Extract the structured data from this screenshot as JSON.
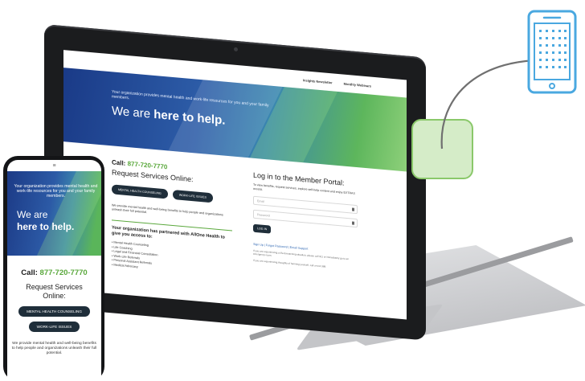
{
  "laptop": {
    "nav": [
      "Insights Newsletter",
      "Monthly Webinars"
    ],
    "hero_small": "Your organization provides mental health and work-life resources for you and your family members.",
    "hero_prefix": "We are ",
    "hero_bold": "here to help.",
    "call_label": "Call: ",
    "call_number": "877-720-7770",
    "request_title": "Request Services Online:",
    "btn_mental": "MENTAL HEALTH COUNSELING",
    "btn_worklife": "WORK-LIFE ISSUES",
    "para": "We provide mental health and well-being benefits to help people and organizations unleash their full potential.",
    "partner_text": "Your organization has partnered with AllOne Health to give you access to:",
    "list": [
      "Mental Health Counseling",
      "Life Coaching",
      "Legal and Financial Consultation",
      "Work-Life Referrals",
      "Personal Assistant Referrals",
      "Medical Advocacy"
    ],
    "login_title": "Log in to the Member Portal:",
    "login_desc": "To view benefits, request services, explore self-help content and enjoy EXTRAS access.",
    "email_placeholder": "Email",
    "password_placeholder": "Password",
    "login_button": "LOG IN",
    "forgot": "Sign Up | Forgot Password | Email Support",
    "note1": "If you are experiencing a life-threatening situation, please call 911 or immediately go to an emergency room.",
    "note2": "If you are experiencing thoughts of harming yourself, call or text 988."
  },
  "phone": {
    "hero_small": "Your organization provides mental health and work-life resources for you and your family members.",
    "hero_big_line1": "We are",
    "hero_big_line2": "here to help.",
    "call_label": "Call: ",
    "call_number": "877-720-7770",
    "request_line1": "Request Services",
    "request_line2": "Online:",
    "btn_mental": "MENTAL HEALTH COUNSELING",
    "btn_worklife": "WORK-LIFE ISSUES",
    "para": "We provide mental health and well-being benefits to help people and organizations unleash their full potential."
  },
  "icons": {
    "tablet": "tablet-icon",
    "green_square": "rounded-square-icon",
    "arrow": "curved-arrow-icon"
  },
  "colors": {
    "accent_green": "#5aa83c",
    "button_dark": "#1f2e3a",
    "icon_blue": "#4aa8e0",
    "square_fill": "#d5ecc8",
    "square_border": "#8ac86a"
  }
}
